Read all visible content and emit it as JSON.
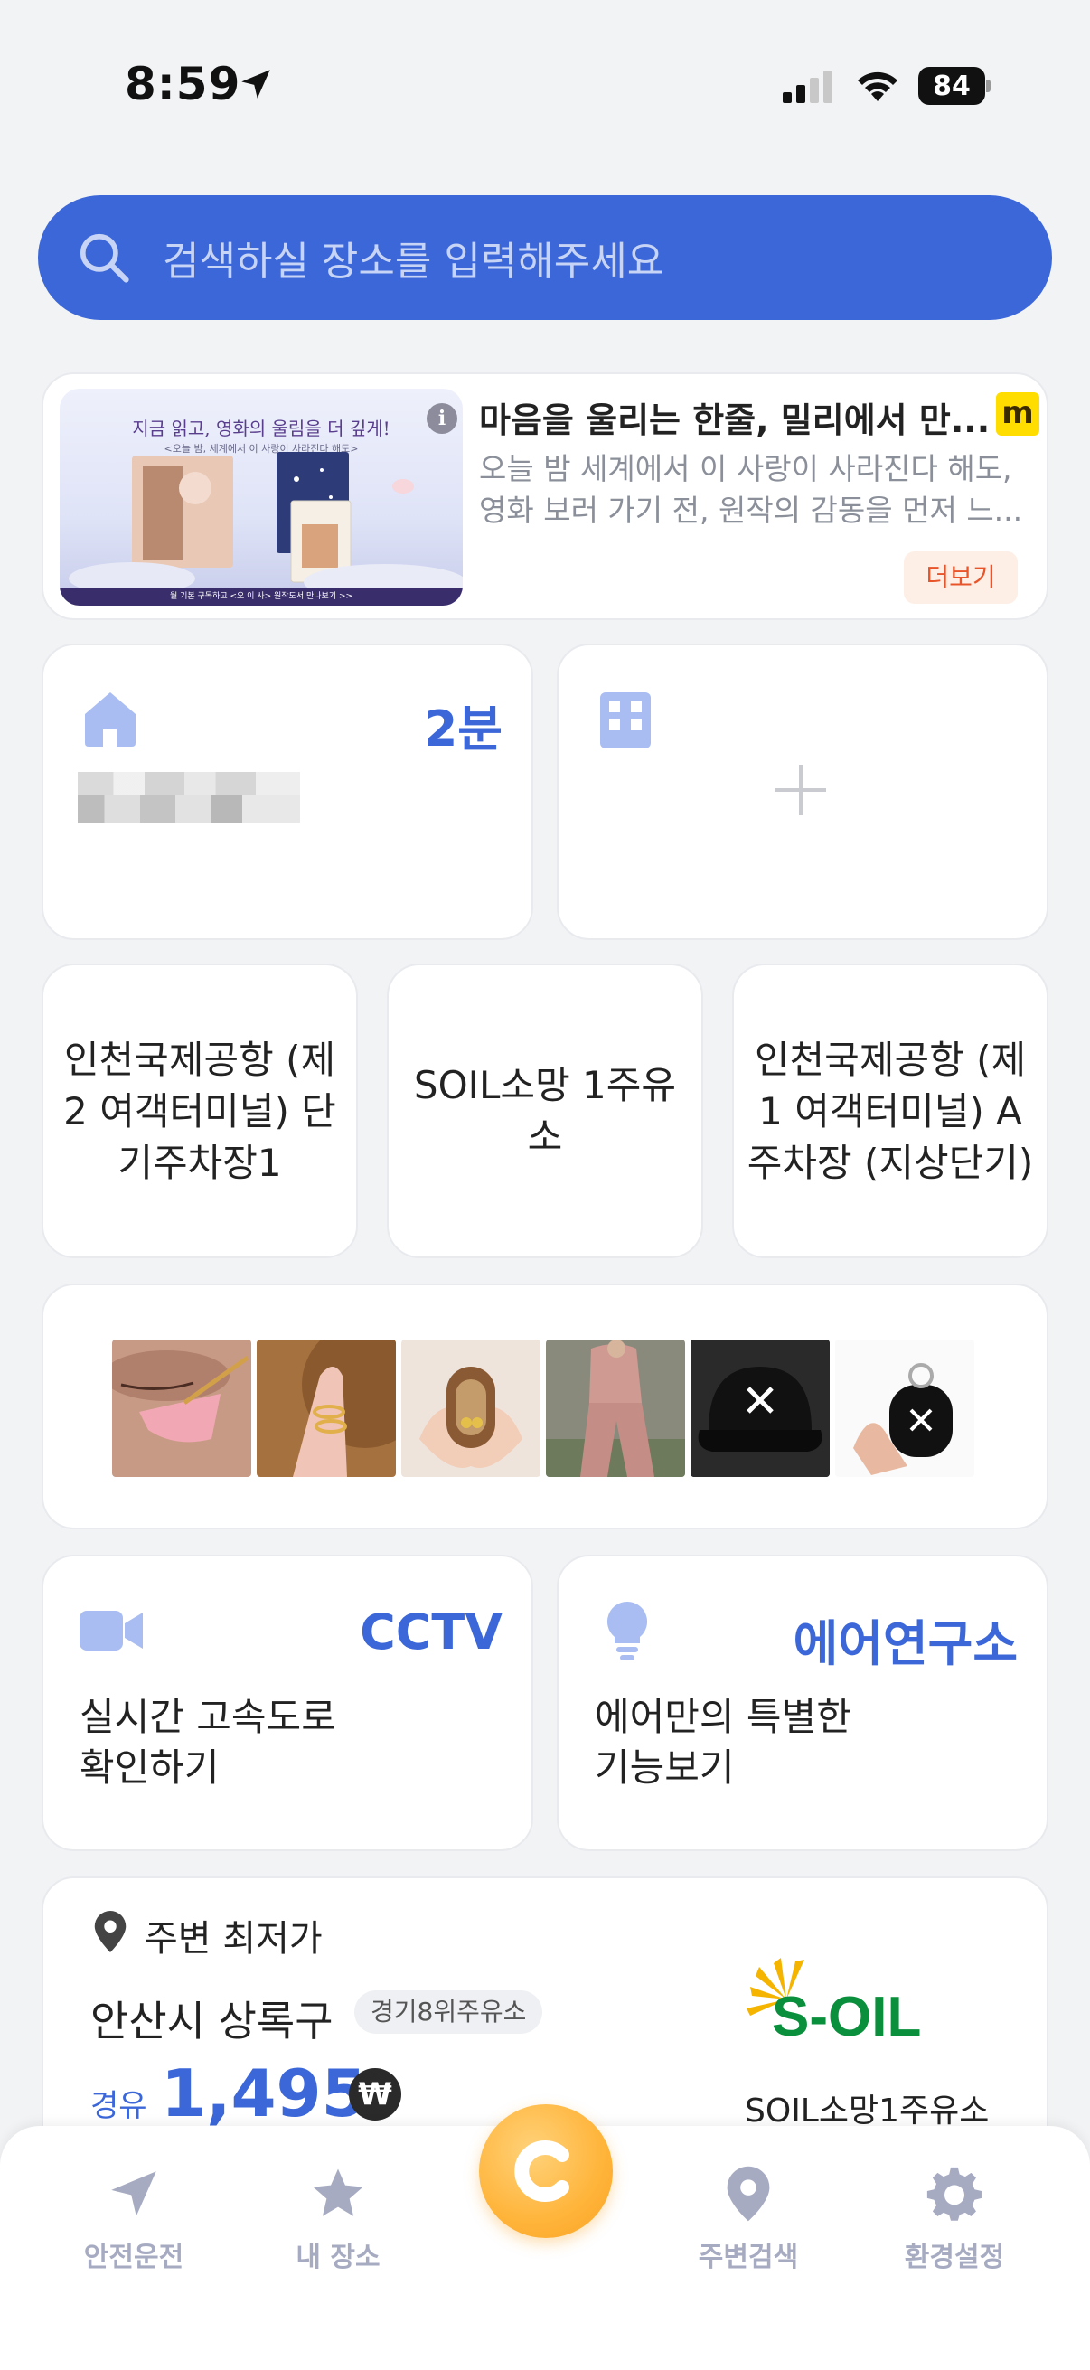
{
  "status_bar": {
    "time": "8:59",
    "battery": "84"
  },
  "search": {
    "placeholder": "검색하실 장소를 입력해주세요"
  },
  "ad": {
    "title": "마음을 울리는 한줄, 밀리에서 만...",
    "description": "오늘 밤 세계에서 이 사랑이 사라진다 해도, 영화 보러 가기 전, 원작의 감동을 먼저 느...",
    "more_label": "더보기",
    "image_headline": "지금 읽고, 영화의 울림을 더 깊게!",
    "image_sub": "<오늘 밤, 세계에서 이 사랑이 사라진다 해도>",
    "image_footer": "월 기본 구독하고 <오 이 사> 원작도서 만나보기 >>",
    "logo": "m"
  },
  "favorites": {
    "home": {
      "time": "2분"
    }
  },
  "recent_places": [
    {
      "name": "인천국제공항 (제2 여객터미널) 단기주차장1"
    },
    {
      "name": "SOIL소망 1주유소"
    },
    {
      "name": "인천국제공항 (제1 여객터미널) A 주차장 (지상단기)"
    }
  ],
  "features": {
    "cctv": {
      "title": "CCTV",
      "desc": "실시간 고속도로\n확인하기"
    },
    "air": {
      "title": "에어연구소",
      "desc": "에어만의 특별한\n기능보기"
    }
  },
  "lowest_price": {
    "label": "주변 최저가",
    "area": "안산시 상록구",
    "badge": "경기8위주유소",
    "fuel": "경유",
    "price": "1,495",
    "currency": "₩",
    "station": "SOIL소망1주유소",
    "brand": "S-OIL"
  },
  "tabbar": {
    "items": [
      {
        "label": "안전운전"
      },
      {
        "label": "내 장소"
      },
      {
        "label": "주변검색"
      },
      {
        "label": "환경설정"
      }
    ]
  },
  "colors": {
    "accent": "#3b67d9",
    "tab_inactive": "#a6abc2",
    "orange": "#ffb43a"
  }
}
